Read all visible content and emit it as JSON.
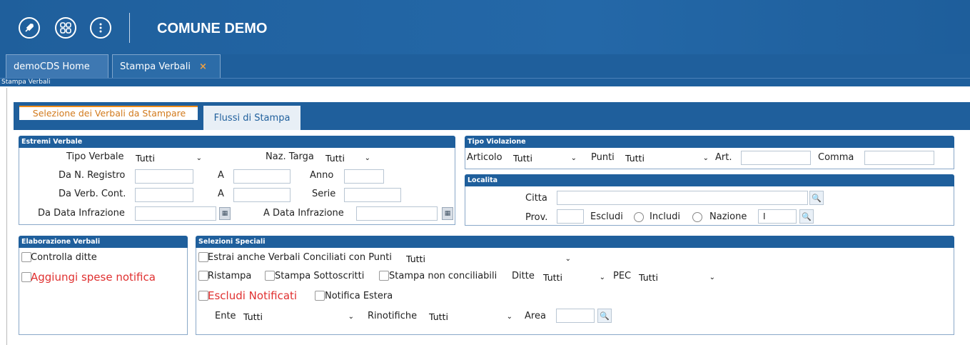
{
  "app": {
    "title": "COMUNE DEMO"
  },
  "header_icons": [
    "rocket-icon",
    "grid-icon",
    "info-icon"
  ],
  "tabs": [
    {
      "label": "demoCDS Home"
    },
    {
      "label": "Stampa Verbali",
      "close": "×"
    }
  ],
  "breadcrumb": "Stampa Verbali",
  "window_tabs": [
    {
      "label": "Selezione dei Verbali da Stampare"
    },
    {
      "label": "Flussi di Stampa"
    }
  ],
  "estremi": {
    "title": "Estremi Verbale",
    "tipo_verbale": {
      "label": "Tipo Verbale",
      "value": "Tutti"
    },
    "naz_targa": {
      "label": "Naz. Targa",
      "value": "Tutti"
    },
    "da_registro": "Da N. Registro",
    "a1": "A",
    "anno": "Anno",
    "da_verb": "Da Verb. Cont.",
    "a2": "A",
    "serie": "Serie",
    "da_data": "Da Data Infrazione",
    "a_data": "A Data Infrazione"
  },
  "tipo_violazione": {
    "title": "Tipo Violazione",
    "articolo": {
      "label": "Articolo",
      "value": "Tutti"
    },
    "punti": {
      "label": "Punti",
      "value": "Tutti"
    },
    "art": "Art.",
    "comma": "Comma"
  },
  "localita": {
    "title": "Localita",
    "citta": "Citta",
    "prov": "Prov.",
    "escludi": "Escludi",
    "includi": "Includi",
    "nazione": "Nazione",
    "nazione_value": "I"
  },
  "elaborazione": {
    "title": "Elaborazione Verbali",
    "controlla": "Controlla ditte",
    "aggiungi": "Aggiungi spese notifica"
  },
  "selezioni": {
    "title": "Selezioni Speciali",
    "estrai": {
      "label": "Estrai anche Verbali Conciliati con Punti",
      "value": "Tutti"
    },
    "ristampa": "Ristampa",
    "sottoscritti": "Stampa Sottoscritti",
    "non_conciliabili": "Stampa non conciliabili",
    "ditte": {
      "label": "Ditte",
      "value": "Tutti"
    },
    "pec": {
      "label": "PEC",
      "value": "Tutti"
    },
    "escludi_notificati": "Escludi Notificati",
    "notifica_estera": "Notifica Estera",
    "ente": {
      "label": "Ente",
      "value": "Tutti"
    },
    "rinotifiche": {
      "label": "Rinotifiche",
      "value": "Tutti"
    },
    "area": "Area"
  },
  "colors": {
    "primary": "#1f5f9c",
    "accent": "#f08c1a",
    "warning_text": "#e03030"
  }
}
